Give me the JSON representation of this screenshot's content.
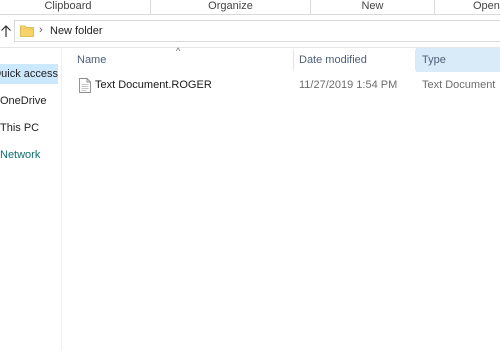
{
  "ribbon": {
    "groups": [
      "Clipboard",
      "Organize",
      "New",
      "Open"
    ]
  },
  "address": {
    "breadcrumb": "New folder",
    "separator": "›"
  },
  "nav": {
    "items": [
      {
        "label": "Quick access",
        "selected": true
      },
      {
        "label": "OneDrive"
      },
      {
        "label": "This PC"
      },
      {
        "label": "Network"
      }
    ]
  },
  "columns": {
    "name": "Name",
    "date_modified": "Date modified",
    "type": "Type"
  },
  "files": [
    {
      "name": "Text Document.ROGER",
      "date_modified": "11/27/2019 1:54 PM",
      "type": "Text Document"
    }
  ],
  "colors": {
    "selection": "#cce8ff",
    "header_active": "#d9ebf9",
    "header_text": "#4c607a",
    "folder": "#f6d46b"
  }
}
